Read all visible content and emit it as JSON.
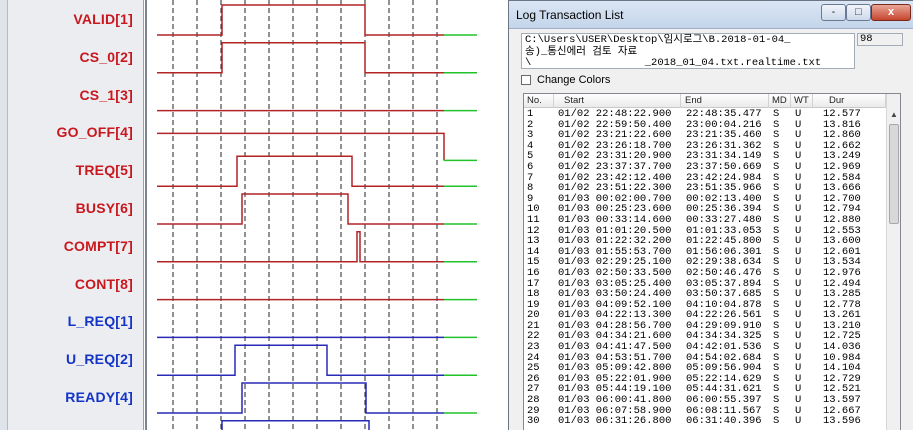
{
  "signals": [
    {
      "label": "VALID[1]",
      "color": "#c8181e",
      "wave_color": "#b22426",
      "edges": [
        75,
        218
      ]
    },
    {
      "label": "CS_0[2]",
      "color": "#c8181e",
      "wave_color": "#b22426",
      "edges": [
        75,
        218
      ]
    },
    {
      "label": "CS_1[3]",
      "color": "#c8181e",
      "wave_color": "#b22426",
      "edges": []
    },
    {
      "label": "GO_OFF[4]",
      "color": "#c8181e",
      "wave_color": "#b22426",
      "edges": [
        0,
        297
      ]
    },
    {
      "label": "TREQ[5]",
      "color": "#c8181e",
      "wave_color": "#b22426",
      "edges": [
        90,
        205
      ]
    },
    {
      "label": "BUSY[6]",
      "color": "#c8181e",
      "wave_color": "#b22426",
      "edges": [
        95,
        201
      ]
    },
    {
      "label": "COMPT[7]",
      "color": "#c8181e",
      "wave_color": "#b22426",
      "edges": [
        210,
        213
      ]
    },
    {
      "label": "CONT[8]",
      "color": "#c8181e",
      "wave_color": "#b22426",
      "edges": []
    },
    {
      "label": "L_REQ[1]",
      "color": "#1434c8",
      "wave_color": "#2a2ab8",
      "edges": []
    },
    {
      "label": "U_REQ[2]",
      "color": "#1434c8",
      "wave_color": "#2a2ab8",
      "edges": [
        88,
        180
      ]
    },
    {
      "label": "READY[4]",
      "color": "#1434c8",
      "wave_color": "#2a2ab8",
      "edges": [
        95,
        219
      ]
    },
    {
      "label": "",
      "color": "#1434c8",
      "wave_color": "#2a2ab8",
      "edges": [
        75,
        222
      ]
    }
  ],
  "colors": {
    "tail_green": "#22c22a",
    "grid_dash": "#222222",
    "plc_red": "#c8181e",
    "io_blue": "#1434c8"
  },
  "log_window": {
    "title": "Log Transaction List",
    "buttons": {
      "minimize": "-",
      "maximize": "□",
      "close": "x"
    },
    "path_lines": [
      "C:\\Users\\USER\\Desktop\\임시로그\\B.2018-01-04_",
      "송)_통신에러 검토 자료",
      "\\                  _2018_01_04.txt.realtime.txt"
    ],
    "count": "98",
    "change_colors_label": "Change Colors",
    "columns": [
      "No.",
      "Start",
      "End",
      "MD",
      "WT",
      "Dur"
    ],
    "rows": [
      [
        "1",
        "01/02 22:48:22.900",
        "22:48:35.477",
        "S",
        "U",
        "12.577"
      ],
      [
        "2",
        "01/02 22:59:50.400",
        "23:00:04.216",
        "S",
        "U",
        "13.816"
      ],
      [
        "3",
        "01/02 23:21:22.600",
        "23:21:35.460",
        "S",
        "U",
        "12.860"
      ],
      [
        "4",
        "01/02 23:26:18.700",
        "23:26:31.362",
        "S",
        "U",
        "12.662"
      ],
      [
        "5",
        "01/02 23:31:20.900",
        "23:31:34.149",
        "S",
        "U",
        "13.249"
      ],
      [
        "6",
        "01/02 23:37:37.700",
        "23:37:50.669",
        "S",
        "U",
        "12.969"
      ],
      [
        "7",
        "01/02 23:42:12.400",
        "23:42:24.984",
        "S",
        "U",
        "12.584"
      ],
      [
        "8",
        "01/02 23:51:22.300",
        "23:51:35.966",
        "S",
        "U",
        "13.666"
      ],
      [
        "9",
        "01/03 00:02:00.700",
        "00:02:13.400",
        "S",
        "U",
        "12.700"
      ],
      [
        "10",
        "01/03 00:25:23.600",
        "00:25:36.394",
        "S",
        "U",
        "12.794"
      ],
      [
        "11",
        "01/03 00:33:14.600",
        "00:33:27.480",
        "S",
        "U",
        "12.880"
      ],
      [
        "12",
        "01/03 01:01:20.500",
        "01:01:33.053",
        "S",
        "U",
        "12.553"
      ],
      [
        "13",
        "01/03 01:22:32.200",
        "01:22:45.800",
        "S",
        "U",
        "13.600"
      ],
      [
        "14",
        "01/03 01:55:53.700",
        "01:56:06.301",
        "S",
        "U",
        "12.601"
      ],
      [
        "15",
        "01/03 02:29:25.100",
        "02:29:38.634",
        "S",
        "U",
        "13.534"
      ],
      [
        "16",
        "01/03 02:50:33.500",
        "02:50:46.476",
        "S",
        "U",
        "12.976"
      ],
      [
        "17",
        "01/03 03:05:25.400",
        "03:05:37.894",
        "S",
        "U",
        "12.494"
      ],
      [
        "18",
        "01/03 03:50:24.400",
        "03:50:37.685",
        "S",
        "U",
        "13.285"
      ],
      [
        "19",
        "01/03 04:09:52.100",
        "04:10:04.878",
        "S",
        "U",
        "12.778"
      ],
      [
        "20",
        "01/03 04:22:13.300",
        "04:22:26.561",
        "S",
        "U",
        "13.261"
      ],
      [
        "21",
        "01/03 04:28:56.700",
        "04:29:09.910",
        "S",
        "U",
        "13.210"
      ],
      [
        "22",
        "01/03 04:34:21.600",
        "04:34:34.325",
        "S",
        "U",
        "12.725"
      ],
      [
        "23",
        "01/03 04:41:47.500",
        "04:42:01.536",
        "S",
        "U",
        "14.036"
      ],
      [
        "24",
        "01/03 04:53:51.700",
        "04:54:02.684",
        "S",
        "U",
        "10.984"
      ],
      [
        "25",
        "01/03 05:09:42.800",
        "05:09:56.904",
        "S",
        "U",
        "14.104"
      ],
      [
        "26",
        "01/03 05:22:01.900",
        "05:22:14.629",
        "S",
        "U",
        "12.729"
      ],
      [
        "27",
        "01/03 05:44:19.100",
        "05:44:31.621",
        "S",
        "U",
        "12.521"
      ],
      [
        "28",
        "01/03 06:00:41.800",
        "06:00:55.397",
        "S",
        "U",
        "13.597"
      ],
      [
        "29",
        "01/03 06:07:58.900",
        "06:08:11.567",
        "S",
        "U",
        "12.667"
      ],
      [
        "30",
        "01/03 06:31:26.800",
        "06:31:40.396",
        "S",
        "U",
        "13.596"
      ]
    ]
  }
}
